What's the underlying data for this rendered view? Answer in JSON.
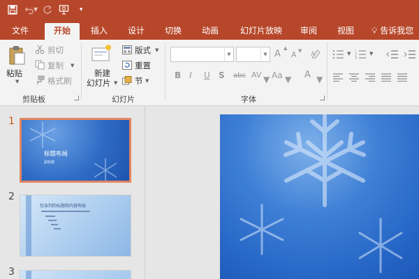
{
  "quick_access": {
    "save_icon": "save-icon",
    "undo_icon": "undo-icon",
    "redo_icon": "redo-icon",
    "present_icon": "present-from-start-icon",
    "customize_icon": "customize-qat-icon"
  },
  "tabs": [
    {
      "label": "文件"
    },
    {
      "label": "开始"
    },
    {
      "label": "插入"
    },
    {
      "label": "设计"
    },
    {
      "label": "切换"
    },
    {
      "label": "动画"
    },
    {
      "label": "幻灯片放映"
    },
    {
      "label": "审阅"
    },
    {
      "label": "视图"
    }
  ],
  "active_tab": "开始",
  "tell_me": "告诉我您",
  "ribbon": {
    "clipboard": {
      "paste": "粘贴",
      "cut": "剪切",
      "copy": "复制",
      "format_painter": "格式刷",
      "group": "剪贴板"
    },
    "slides": {
      "new_slide_line1": "新建",
      "new_slide_line2": "幻灯片",
      "layout": "版式",
      "reset": "重置",
      "section": "节",
      "group": "幻灯片"
    },
    "font": {
      "font_name": "",
      "font_size": "",
      "bold": "B",
      "italic": "I",
      "underline": "U",
      "shadow": "S",
      "strikethrough": "abc",
      "spacing": "AV",
      "change_case": "Aa",
      "font_color": "A",
      "grow": "A",
      "shrink": "A",
      "group": "字体"
    }
  },
  "slides": [
    {
      "number": "1",
      "title": "标题布局",
      "subtitle": "副标题"
    },
    {
      "number": "2",
      "title": "包含列的标题和内容布局"
    },
    {
      "number": "3"
    }
  ],
  "colors": {
    "accent": "#b7472a",
    "ribbon_bg": "#f3f3f3",
    "selection_border": "#e4865f"
  }
}
